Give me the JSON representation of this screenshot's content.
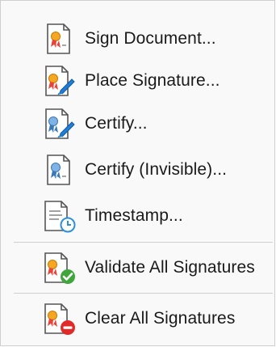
{
  "menu": {
    "items": [
      {
        "label": "Sign Document...",
        "icon": "sign-document-icon"
      },
      {
        "label": "Place Signature...",
        "icon": "place-signature-icon"
      },
      {
        "label": "Certify...",
        "icon": "certify-icon"
      },
      {
        "label": "Certify (Invisible)...",
        "icon": "certify-invisible-icon"
      },
      {
        "label": "Timestamp...",
        "icon": "timestamp-icon"
      },
      {
        "label": "Validate All Signatures",
        "icon": "validate-all-signatures-icon"
      },
      {
        "label": "Clear All Signatures",
        "icon": "clear-all-signatures-icon"
      }
    ]
  },
  "colors": {
    "menu_bg": "#f9f9f9",
    "separator": "#d0d0d0",
    "ribbon_red": "#e8433a",
    "seal_orange": "#f5a623",
    "pen_blue": "#1f7fd6",
    "check_green": "#3ea63a",
    "clear_red": "#e02a2a",
    "clock_blue": "#2b8fe0"
  }
}
